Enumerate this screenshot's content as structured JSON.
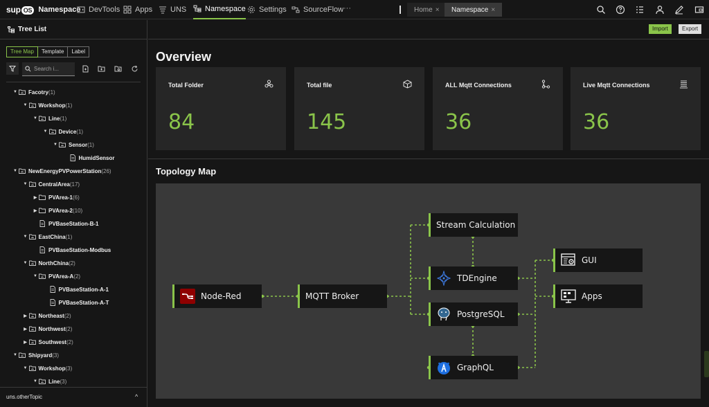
{
  "nav": {
    "brand": "Namespace",
    "items": [
      {
        "label": "DevTools",
        "icon": "devtools-icon"
      },
      {
        "label": "Apps",
        "icon": "apps-icon"
      },
      {
        "label": "UNS",
        "icon": "uns-icon"
      },
      {
        "label": "Namespace",
        "icon": "namespace-icon",
        "active": true
      },
      {
        "label": "Settings",
        "icon": "gear-icon"
      },
      {
        "label": "SourceFlow",
        "icon": "sourceflow-icon"
      }
    ],
    "more": "···",
    "tabs": [
      {
        "label": "Home",
        "active": false
      },
      {
        "label": "Namespace",
        "active": true
      }
    ],
    "right_icons": [
      "search-icon",
      "help-icon",
      "list-icon",
      "user-icon",
      "edit-icon",
      "window-icon"
    ]
  },
  "sidebar": {
    "title": "Tree List",
    "segments": [
      "Tree Map",
      "Template",
      "Label"
    ],
    "active_segment": "Tree Map",
    "search_placeholder": "Search i...",
    "tree": [
      {
        "label": "Facotry",
        "count": "(1)",
        "level": 0,
        "expanded": true,
        "type": "folder"
      },
      {
        "label": "Workshop",
        "count": "(1)",
        "level": 1,
        "expanded": true,
        "type": "folder"
      },
      {
        "label": "Line",
        "count": "(1)",
        "level": 2,
        "expanded": true,
        "type": "folder"
      },
      {
        "label": "Device",
        "count": "(1)",
        "level": 3,
        "expanded": true,
        "type": "folder"
      },
      {
        "label": "Sensor",
        "count": "(1)",
        "level": 4,
        "expanded": true,
        "type": "folder"
      },
      {
        "label": "HumidSensor",
        "count": "",
        "level": 5,
        "type": "file"
      },
      {
        "label": "NewEnergyPVPowerStation",
        "count": "(26)",
        "level": 0,
        "expanded": true,
        "type": "folder"
      },
      {
        "label": "CentralArea",
        "count": "(17)",
        "level": 1,
        "expanded": true,
        "type": "folder"
      },
      {
        "label": "PVArea-1",
        "count": "(6)",
        "level": 2,
        "expanded": false,
        "type": "folder-open"
      },
      {
        "label": "PVArea-2",
        "count": "(10)",
        "level": 2,
        "expanded": false,
        "type": "folder-open"
      },
      {
        "label": "PVBaseStation-B-1",
        "count": "",
        "level": 2,
        "type": "file"
      },
      {
        "label": "EastChina",
        "count": "(1)",
        "level": 1,
        "expanded": true,
        "type": "folder"
      },
      {
        "label": "PVBaseStation-Modbus",
        "count": "",
        "level": 2,
        "type": "file"
      },
      {
        "label": "NorthChina",
        "count": "(2)",
        "level": 1,
        "expanded": true,
        "type": "folder"
      },
      {
        "label": "PVArea-A",
        "count": "(2)",
        "level": 2,
        "expanded": true,
        "type": "folder"
      },
      {
        "label": "PVBaseStation-A-1",
        "count": "",
        "level": 3,
        "type": "file"
      },
      {
        "label": "PVBaseStation-A-T",
        "count": "",
        "level": 3,
        "type": "file"
      },
      {
        "label": "Northeast",
        "count": "(2)",
        "level": 1,
        "expanded": false,
        "type": "folder"
      },
      {
        "label": "Northwest",
        "count": "(2)",
        "level": 1,
        "expanded": false,
        "type": "folder"
      },
      {
        "label": "Southwest",
        "count": "(2)",
        "level": 1,
        "expanded": false,
        "type": "folder"
      },
      {
        "label": "Shipyard",
        "count": "(3)",
        "level": 0,
        "expanded": true,
        "type": "folder"
      },
      {
        "label": "Workshop",
        "count": "(3)",
        "level": 1,
        "expanded": true,
        "type": "folder"
      },
      {
        "label": "Line",
        "count": "(3)",
        "level": 2,
        "expanded": true,
        "type": "folder"
      }
    ],
    "bottom_label": "uns.otherTopic",
    "bottom_chevron": "^"
  },
  "toolbar": {
    "import_label": "Import",
    "export_label": "Export"
  },
  "overview": {
    "title": "Overview",
    "cards": [
      {
        "label": "Total Folder",
        "value": "84",
        "icon": "folder-network-icon"
      },
      {
        "label": "Total file",
        "value": "145",
        "icon": "cube-icon"
      },
      {
        "label": "ALL Mqtt Connections",
        "value": "36",
        "icon": "branch-icon"
      },
      {
        "label": "Live Mqtt Connections",
        "value": "36",
        "icon": "stack-icon"
      }
    ]
  },
  "topology": {
    "title": "Topology Map",
    "nodes": {
      "nodered": {
        "label": "Node-Red",
        "icon": "node-red-icon"
      },
      "mqtt": {
        "label": "MQTT Broker",
        "icon": ""
      },
      "stream": {
        "label": "Stream Calculation",
        "icon": ""
      },
      "tdengine": {
        "label": "TDEngine",
        "icon": "tdengine-icon"
      },
      "postgres": {
        "label": "PostgreSQL",
        "icon": "postgresql-icon"
      },
      "graphql": {
        "label": "GraphQL",
        "icon": "graphql-icon"
      },
      "gui": {
        "label": "GUI",
        "icon": "gui-icon"
      },
      "apps": {
        "label": "Apps",
        "icon": "apps-monitor-icon"
      }
    },
    "accent": "#8ac44a"
  },
  "colors": {
    "accent": "#8ac44a",
    "background": "#161616",
    "card": "#262626",
    "canvas": "#393939"
  }
}
